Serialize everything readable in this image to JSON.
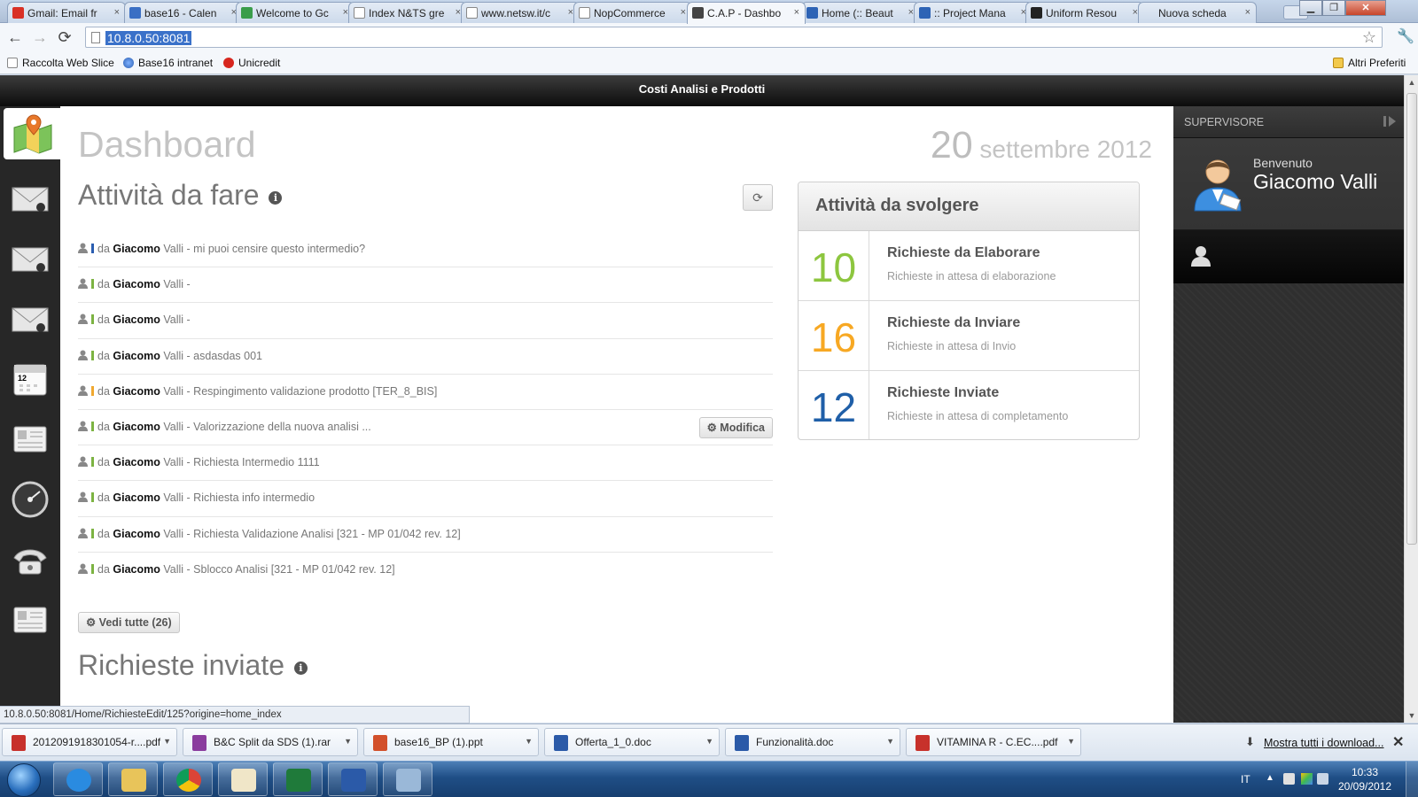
{
  "browser": {
    "tabs": [
      {
        "label": "Gmail: Email fr",
        "icon": "gmail-icon",
        "color": "#d93025"
      },
      {
        "label": "base16 - Calen",
        "icon": "calendar-icon",
        "color": "#3a6fc4"
      },
      {
        "label": "Welcome to Gc",
        "icon": "google-icon",
        "color": "#3a9d4a"
      },
      {
        "label": "Index N&TS gre",
        "icon": "page-icon",
        "color": "#ffffff"
      },
      {
        "label": "www.netsw.it/c",
        "icon": "page-icon",
        "color": "#ffffff"
      },
      {
        "label": "NopCommerce",
        "icon": "page-icon",
        "color": "#ffffff"
      },
      {
        "label": "C.A.P - Dashbo",
        "icon": "gear-icon",
        "color": "#444444"
      },
      {
        "label": "Home (:: Beaut",
        "icon": "globe-icon",
        "color": "#2d63b5"
      },
      {
        "label": ":: Project Mana",
        "icon": "globe-icon",
        "color": "#2d63b5"
      },
      {
        "label": "Uniform Resou",
        "icon": "wikipedia-icon",
        "color": "#222222"
      },
      {
        "label": "Nuova scheda",
        "icon": "none",
        "color": "#ffffff"
      }
    ],
    "url": "10.8.0.50:8081",
    "bookmarks": [
      {
        "label": "Raccolta Web Slice",
        "icon": "page-icon"
      },
      {
        "label": "Base16 intranet",
        "icon": "globe-icon"
      },
      {
        "label": "Unicredit",
        "icon": "unicredit-icon"
      }
    ],
    "other_bookmarks": "Altri Preferiti",
    "status_url": "10.8.0.50:8081/Home/RichiesteEdit/125?origine=home_index"
  },
  "app": {
    "header_title": "Costi Analisi e Prodotti",
    "nav_icons": [
      "map-icon",
      "mail-icon",
      "mail-icon",
      "mail-icon",
      "calendar-icon",
      "document-icon",
      "gauge-icon",
      "phone-icon",
      "document-icon"
    ]
  },
  "dashboard": {
    "title": "Dashboard",
    "date_day": "20",
    "date_rest": " settembre 2012",
    "todo_title": "Attività da fare",
    "info_glyph": "i",
    "refresh_glyph": "⟳",
    "from_label": "da",
    "activities": [
      {
        "first": "Giacomo",
        "rest": " Valli - mi puoi censire questo intermedio?",
        "priority": "#2a5db0"
      },
      {
        "first": "Giacomo",
        "rest": " Valli -",
        "priority": "#7cb342"
      },
      {
        "first": "Giacomo",
        "rest": " Valli -",
        "priority": "#7cb342"
      },
      {
        "first": "Giacomo",
        "rest": " Valli - asdasdas 001",
        "priority": "#7cb342"
      },
      {
        "first": "Giacomo",
        "rest": " Valli - Respingimento validazione prodotto [TER_8_BIS]",
        "priority": "#f0a830"
      },
      {
        "first": "Giacomo",
        "rest": " Valli - Valorizzazione della nuova analisi ...",
        "priority": "#7cb342",
        "action": "⚙ Modifica"
      },
      {
        "first": "Giacomo",
        "rest": " Valli - Richiesta Intermedio 1111",
        "priority": "#7cb342"
      },
      {
        "first": "Giacomo",
        "rest": " Valli - Richiesta info intermedio",
        "priority": "#7cb342"
      },
      {
        "first": "Giacomo",
        "rest": " Valli - Richiesta Validazione Analisi [321 - MP 01/042 rev. 12]",
        "priority": "#7cb342"
      },
      {
        "first": "Giacomo",
        "rest": " Valli - Sblocco Analisi [321 - MP 01/042 rev. 12]",
        "priority": "#7cb342"
      }
    ],
    "see_all": "⚙ Vedi tutte (26)",
    "sent_title": "Richieste inviate"
  },
  "tasks": {
    "title": "Attività da svolgere",
    "items": [
      {
        "count": "10",
        "title": "Richieste da Elaborare",
        "subtitle": "Richieste in attesa di elaborazione",
        "color": "#8dc63f"
      },
      {
        "count": "16",
        "title": "Richieste da Inviare",
        "subtitle": "Richieste in attesa di Invio",
        "color": "#f7a823"
      },
      {
        "count": "12",
        "title": "Richieste Inviate",
        "subtitle": "Richieste in attesa di completamento",
        "color": "#1f5fa8"
      }
    ]
  },
  "user_panel": {
    "role": "SUPERVISORE",
    "welcome": "Benvenuto",
    "name": "Giacomo Valli"
  },
  "downloads": {
    "items": [
      {
        "label": "2012091918301054-r....pdf",
        "icon": "pdf-icon"
      },
      {
        "label": "B&C Split da SDS (1).rar",
        "icon": "rar-icon"
      },
      {
        "label": "base16_BP (1).ppt",
        "icon": "ppt-icon"
      },
      {
        "label": "Offerta_1_0.doc",
        "icon": "doc-icon"
      },
      {
        "label": "Funzionalità.doc",
        "icon": "doc-icon"
      },
      {
        "label": "VITAMINA R - C.EC....pdf",
        "icon": "pdf-icon"
      }
    ],
    "show_all": "Mostra tutti i download...",
    "close_glyph": "✕"
  },
  "taskbar": {
    "apps": [
      "internet-explorer-icon",
      "file-explorer-icon",
      "chrome-icon",
      "paint-icon",
      "excel-icon",
      "word-icon",
      "remote-desktop-icon"
    ],
    "lang": "IT",
    "time": "10:33",
    "date": "20/09/2012"
  }
}
